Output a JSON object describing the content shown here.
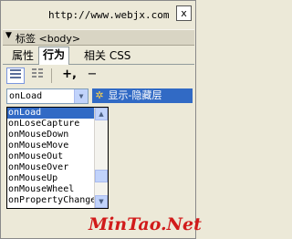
{
  "window": {
    "title": "http://www.webjx.com",
    "close_glyph": "x"
  },
  "panel": {
    "header_arrow": "▼",
    "header_label": "标签 <body>",
    "tabs": [
      {
        "label": "属性"
      },
      {
        "label": "行为"
      },
      {
        "label": "相关 CSS"
      }
    ],
    "active_tab": "行为"
  },
  "toolbar": {
    "show_set_icon": "set-events-icon",
    "show_all_icon": "all-events-icon",
    "add_label": "+,",
    "remove_label": "−",
    "move_up_label": "▲",
    "move_down_label": "▼"
  },
  "event_select": {
    "value": "onLoad"
  },
  "action": {
    "label": "显示-隐藏层",
    "icon": "gear-icon"
  },
  "dropdown": {
    "items": [
      "onLoad",
      "onLoseCapture",
      "onMouseDown",
      "onMouseMove",
      "onMouseOut",
      "onMouseOver",
      "onMouseUp",
      "onMouseWheel",
      "onPropertyChange"
    ],
    "selected_index": 0
  },
  "watermark": {
    "text": "MinTao.Net"
  },
  "colors": {
    "selection": "#316ac5",
    "background": "#ece9d8",
    "watermark": "#d11a1a"
  }
}
